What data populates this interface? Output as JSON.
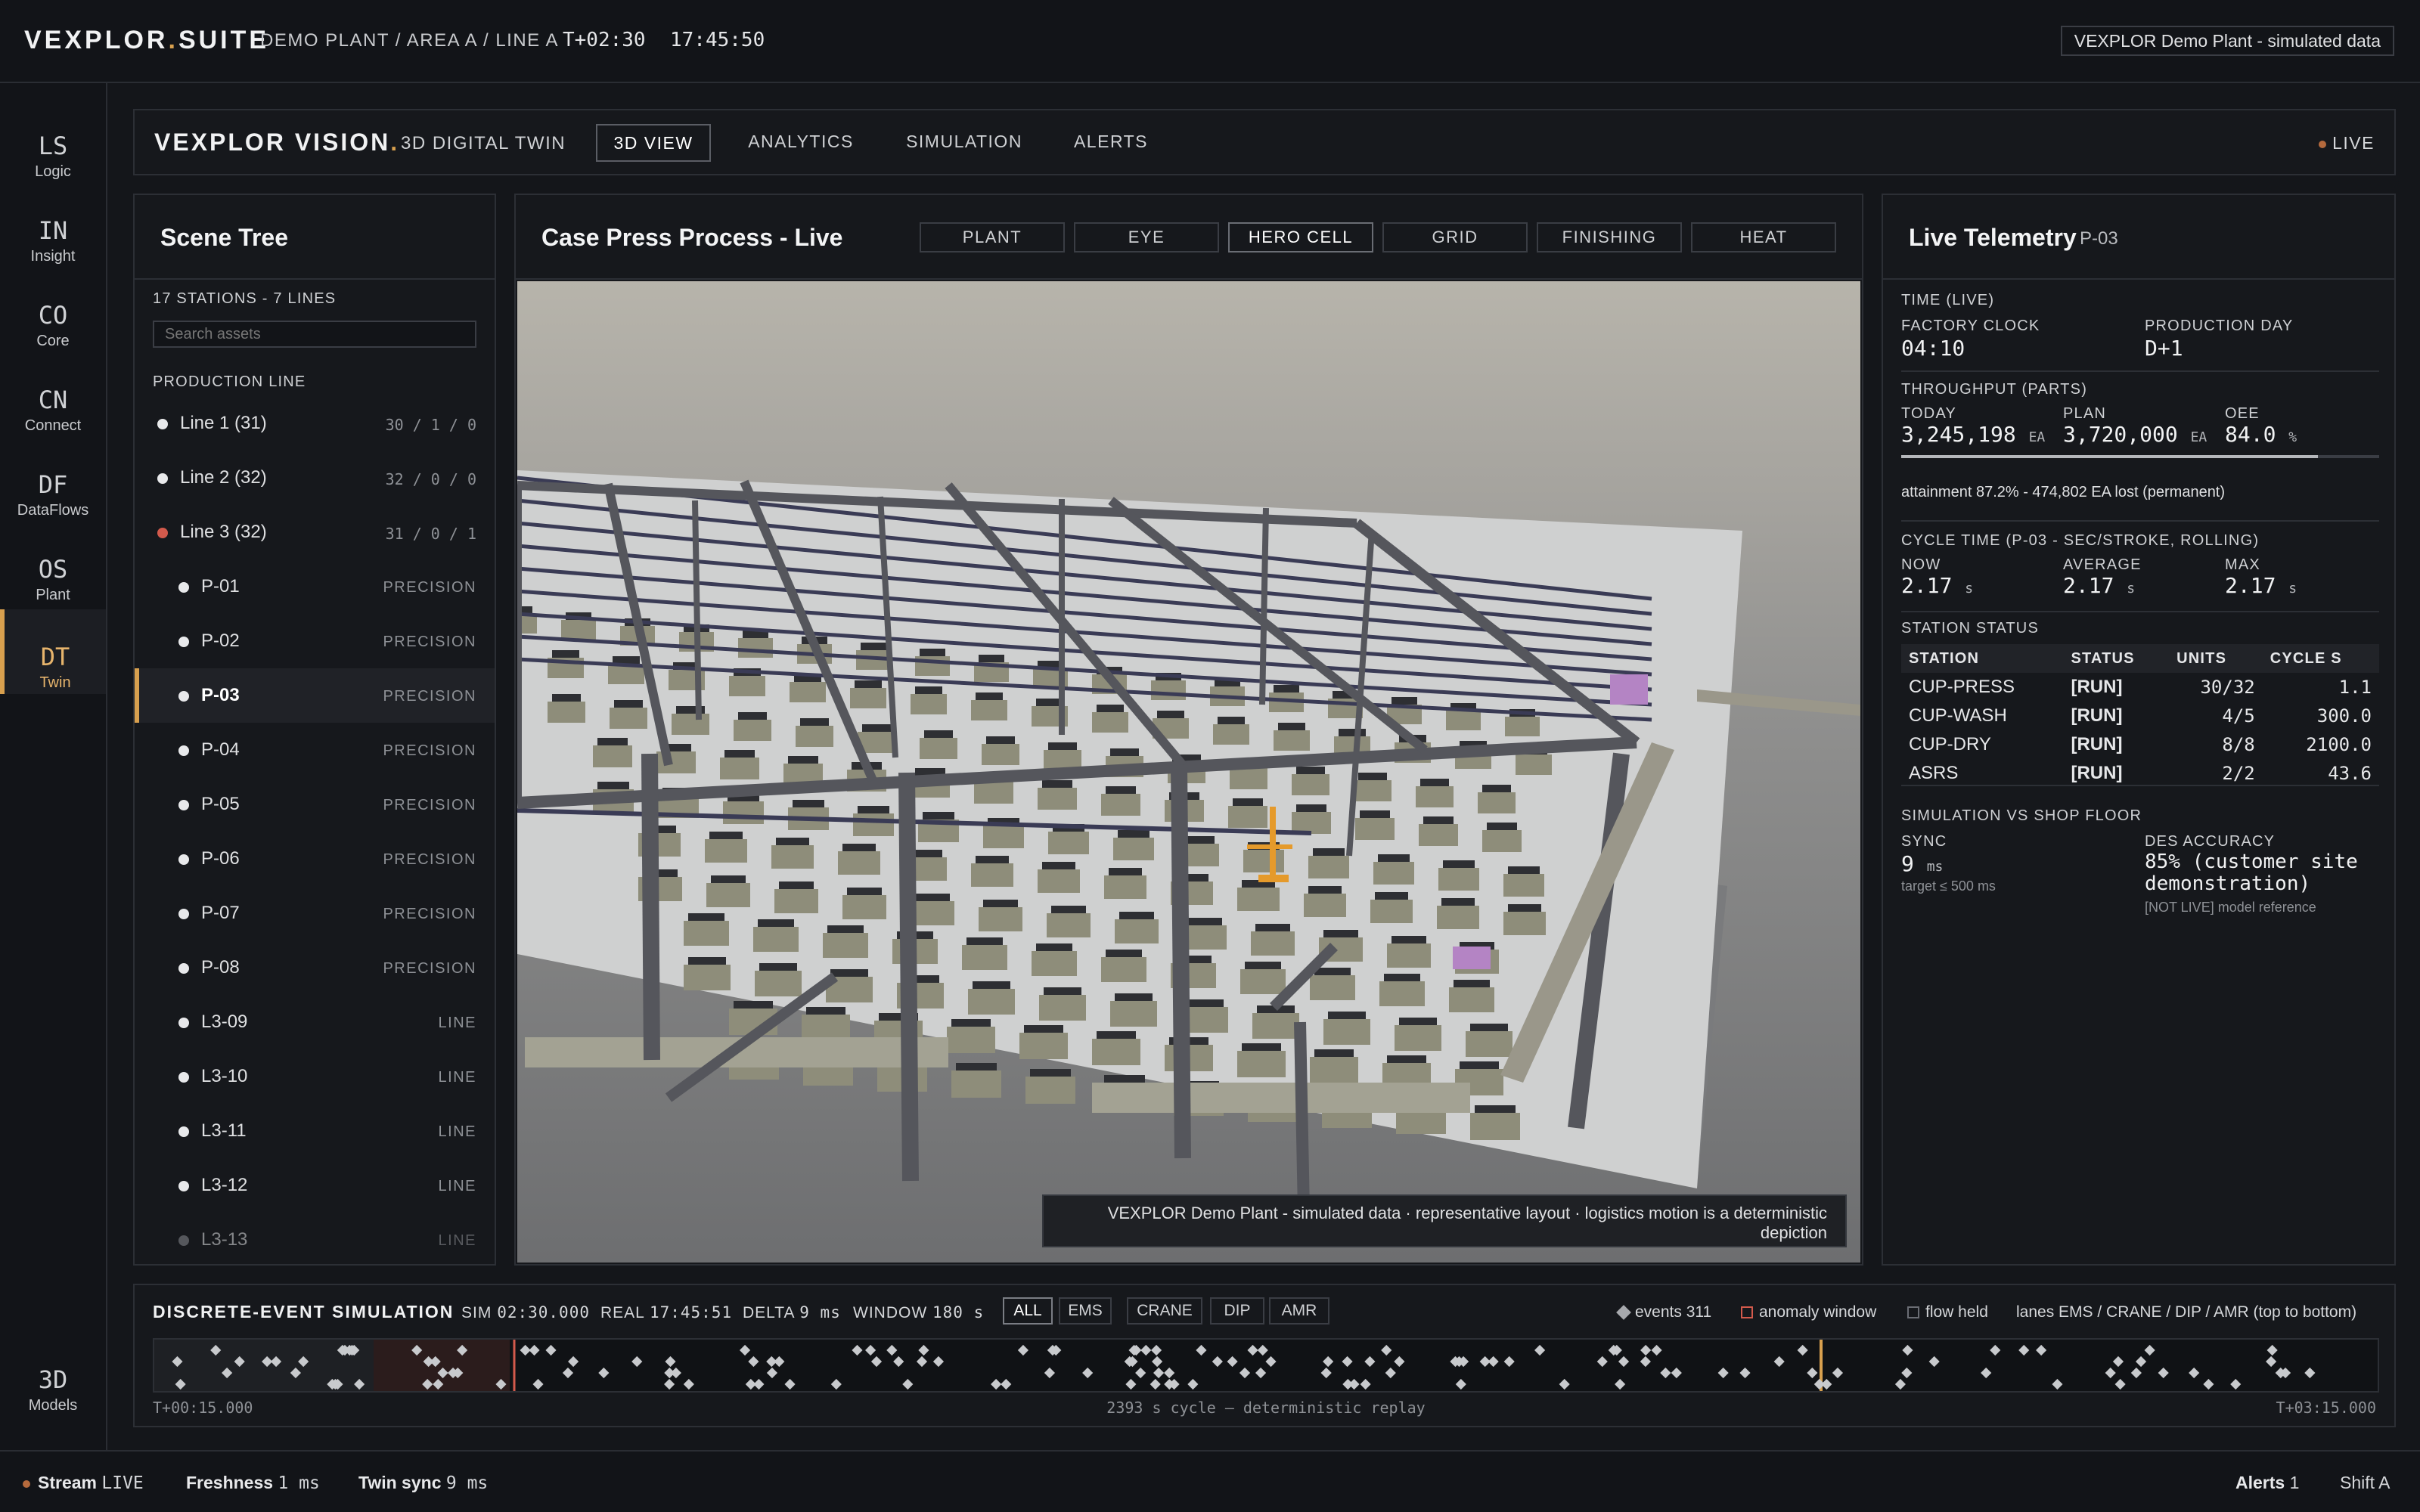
{
  "topbar": {
    "brand_a": "VEXPLOR",
    "brand_dot": ".",
    "brand_b": "SUITE",
    "breadcrumb": "DEMO PLANT / AREA A / LINE A",
    "tplus": "T+02:30",
    "clock": "17:45:50",
    "badge": "VEXPLOR Demo Plant - simulated data"
  },
  "rail": [
    {
      "abbr": "LS",
      "label": "Logic"
    },
    {
      "abbr": "IN",
      "label": "Insight"
    },
    {
      "abbr": "CO",
      "label": "Core"
    },
    {
      "abbr": "CN",
      "label": "Connect"
    },
    {
      "abbr": "DF",
      "label": "DataFlows"
    },
    {
      "abbr": "OS",
      "label": "Plant"
    },
    {
      "abbr": "DT",
      "label": "Twin"
    },
    {
      "abbr": "3D",
      "label": "Models"
    }
  ],
  "vision": {
    "title": "VEXPLOR VISION",
    "title_dot": ".",
    "subtitle": "3D DIGITAL TWIN",
    "tabs": [
      "3D VIEW",
      "ANALYTICS",
      "SIMULATION",
      "ALERTS"
    ],
    "live": "LIVE"
  },
  "tree": {
    "title": "Scene Tree",
    "count": "17 STATIONS - 7 LINES",
    "search_placeholder": "Search assets",
    "section": "PRODUCTION LINE",
    "lines": [
      {
        "label": "Line 1 (31)",
        "counts": "30 / 1 / 0"
      },
      {
        "label": "Line 2 (32)",
        "counts": "32 / 0 / 0"
      },
      {
        "label": "Line 3 (32)",
        "counts": "31 / 0 / 1"
      }
    ],
    "stations": [
      {
        "label": "P-01",
        "tag": "PRECISION"
      },
      {
        "label": "P-02",
        "tag": "PRECISION"
      },
      {
        "label": "P-03",
        "tag": "PRECISION"
      },
      {
        "label": "P-04",
        "tag": "PRECISION"
      },
      {
        "label": "P-05",
        "tag": "PRECISION"
      },
      {
        "label": "P-06",
        "tag": "PRECISION"
      },
      {
        "label": "P-07",
        "tag": "PRECISION"
      },
      {
        "label": "P-08",
        "tag": "PRECISION"
      },
      {
        "label": "L3-09",
        "tag": "LINE"
      },
      {
        "label": "L3-10",
        "tag": "LINE"
      },
      {
        "label": "L3-11",
        "tag": "LINE"
      },
      {
        "label": "L3-12",
        "tag": "LINE"
      },
      {
        "label": "L3-13",
        "tag": "LINE"
      }
    ]
  },
  "viewport": {
    "title": "Case Press Process - Live",
    "buttons": [
      "PLANT",
      "EYE",
      "HERO CELL",
      "GRID",
      "FINISHING",
      "HEAT"
    ],
    "active_button": "HERO CELL",
    "note": "VEXPLOR Demo Plant - simulated data · representative layout · logistics motion is a deterministic depiction"
  },
  "telemetry": {
    "title": "Live Telemetry",
    "station": "P-03",
    "time_caption": "TIME (LIVE)",
    "factory_clock_label": "FACTORY CLOCK",
    "factory_clock": "04:10",
    "production_day_label": "PRODUCTION DAY",
    "production_day": "D+1",
    "throughput_caption": "THROUGHPUT (PARTS)",
    "today_label": "TODAY",
    "today": "3,245,198",
    "today_unit": "EA",
    "plan_label": "PLAN",
    "plan": "3,720,000",
    "plan_unit": "EA",
    "oee_label": "OEE",
    "oee": "84.0",
    "oee_unit": "%",
    "attainment_fraction": 0.872,
    "attainment": "attainment 87.2% - 474,802 EA lost (permanent)",
    "cycle_caption": "CYCLE TIME (P-03 - SEC/STROKE, ROLLING)",
    "now_label": "NOW",
    "now": "2.17",
    "avg_label": "AVERAGE",
    "avg": "2.17",
    "max_label": "MAX",
    "max": "2.17",
    "sec_unit": "s",
    "status_caption": "STATION STATUS",
    "table_headers": [
      "STATION",
      "STATUS",
      "UNITS",
      "CYCLE S"
    ],
    "table_rows": [
      [
        "CUP-PRESS",
        "[RUN]",
        "30/32",
        "1.1"
      ],
      [
        "CUP-WASH",
        "[RUN]",
        "4/5",
        "300.0"
      ],
      [
        "CUP-DRY",
        "[RUN]",
        "8/8",
        "2100.0"
      ],
      [
        "ASRS",
        "[RUN]",
        "2/2",
        "43.6"
      ]
    ],
    "sim_caption": "SIMULATION VS SHOP FLOOR",
    "sync_label": "SYNC",
    "sync": "9",
    "sync_unit": "ms",
    "sync_target": "target ≤ 500 ms",
    "des_label": "DES ACCURACY",
    "des_value": "85% (customer site demonstration)",
    "des_note": "[NOT LIVE] model reference"
  },
  "des": {
    "title": "DISCRETE-EVENT SIMULATION",
    "sim_label": "SIM",
    "sim": "02:30.000",
    "real_label": "REAL",
    "real": "17:45:51",
    "delta_label": "DELTA",
    "delta": "9 ms",
    "window_label": "WINDOW",
    "window": "180 s",
    "filters": [
      "ALL",
      "EMS",
      "CRANE",
      "DIP",
      "AMR"
    ],
    "legend_events": "events 311",
    "legend_anomaly": "anomaly window",
    "legend_flow": "flow held",
    "legend_lanes": "lanes EMS / CRANE / DIP / AMR (top to bottom)",
    "start": "T+00:15.000",
    "caption": "2393 s cycle — deterministic replay",
    "end": "T+03:15.000"
  },
  "status": {
    "stream_label": "Stream",
    "stream": "LIVE",
    "fresh_label": "Freshness",
    "fresh": "1 ms",
    "sync_label": "Twin sync",
    "sync": "9 ms",
    "alerts_label": "Alerts",
    "alerts": "1",
    "shift": "Shift A"
  },
  "colors": {
    "accent": "#d8a04e",
    "alert": "#d35a4c",
    "background": "#14161a"
  }
}
